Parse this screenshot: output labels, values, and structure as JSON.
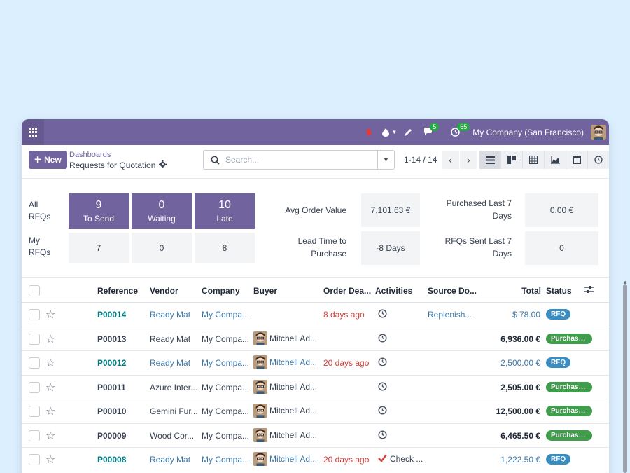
{
  "navbar": {
    "company": "My Company (San Francisco)",
    "chat_count": "5",
    "activity_count": "65"
  },
  "control": {
    "new_label": "New",
    "breadcrumb_parent": "Dashboards",
    "breadcrumb_current": "Requests for Quotation",
    "search_placeholder": "Search...",
    "pager": "1-14 / 14"
  },
  "dashboard": {
    "all_rfqs_label": "All RFQs",
    "my_rfqs_label": "My RFQs",
    "tiles": [
      {
        "all": "9",
        "label": "To Send",
        "mine": "7"
      },
      {
        "all": "0",
        "label": "Waiting",
        "mine": "0"
      },
      {
        "all": "10",
        "label": "Late",
        "mine": "8"
      }
    ],
    "avg_order_label": "Avg Order Value",
    "avg_order_value": "7,101.63 €",
    "lead_time_label": "Lead Time to Purchase",
    "lead_time_value": "-8 Days",
    "purchased_label": "Purchased Last 7 Days",
    "purchased_value": "0.00 €",
    "sent_label": "RFQs Sent Last 7 Days",
    "sent_value": "0"
  },
  "table": {
    "headers": {
      "reference": "Reference",
      "vendor": "Vendor",
      "company": "Company",
      "buyer": "Buyer",
      "deadline": "Order Dea...",
      "activities": "Activities",
      "source": "Source Do...",
      "total": "Total",
      "status": "Status"
    },
    "rows": [
      {
        "ref": "P00014",
        "vendor": "Ready Mat",
        "company": "My Compa...",
        "buyer": "",
        "deadline": "8 days ago",
        "activity": "clock",
        "activity_text": "",
        "source": "Replenish...",
        "total": "$ 78.00",
        "status": "RFQ"
      },
      {
        "ref": "P00013",
        "vendor": "Ready Mat",
        "company": "My Compa...",
        "buyer": "Mitchell Ad...",
        "deadline": "",
        "activity": "clock",
        "activity_text": "",
        "source": "",
        "total": "6,936.00 €",
        "status": "Purchase..."
      },
      {
        "ref": "P00012",
        "vendor": "Ready Mat",
        "company": "My Compa...",
        "buyer": "Mitchell Ad...",
        "deadline": "20 days ago",
        "activity": "clock",
        "activity_text": "",
        "source": "",
        "total": "2,500.00 €",
        "status": "RFQ"
      },
      {
        "ref": "P00011",
        "vendor": "Azure Inter...",
        "company": "My Compa...",
        "buyer": "Mitchell Ad...",
        "deadline": "",
        "activity": "clock",
        "activity_text": "",
        "source": "",
        "total": "2,505.00 €",
        "status": "Purchase..."
      },
      {
        "ref": "P00010",
        "vendor": "Gemini Fur...",
        "company": "My Compa...",
        "buyer": "Mitchell Ad...",
        "deadline": "",
        "activity": "clock",
        "activity_text": "",
        "source": "",
        "total": "12,500.00 €",
        "status": "Purchase..."
      },
      {
        "ref": "P00009",
        "vendor": "Wood Cor...",
        "company": "My Compa...",
        "buyer": "Mitchell Ad...",
        "deadline": "",
        "activity": "clock",
        "activity_text": "",
        "source": "",
        "total": "6,465.50 €",
        "status": "Purchase..."
      },
      {
        "ref": "P00008",
        "vendor": "Ready Mat",
        "company": "My Compa...",
        "buyer": "Mitchell Ad...",
        "deadline": "20 days ago",
        "activity": "check",
        "activity_text": "Check ...",
        "source": "",
        "total": "1,222.50 €",
        "status": "RFQ"
      }
    ]
  },
  "colors": {
    "brand": "#71639e",
    "link": "#017e84",
    "danger": "#d23f3a",
    "rfq_badge": "#3a8dc0",
    "purchase_badge": "#3f9d4c"
  }
}
